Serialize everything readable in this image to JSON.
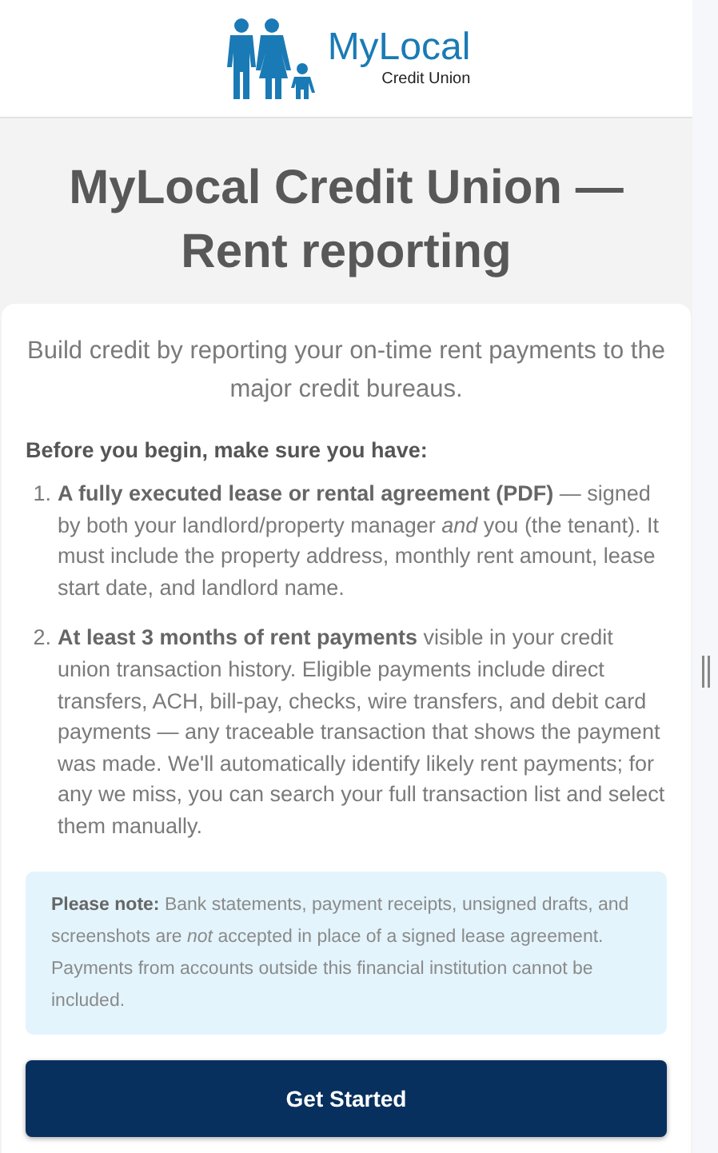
{
  "header": {
    "logo_name": "MyLocal",
    "logo_tagline": "Credit Union"
  },
  "title": "MyLocal Credit Union — Rent reporting",
  "lead": "Build credit by reporting your on-time rent payments to the major credit bureaus.",
  "checklist": {
    "heading": "Before you begin, make sure you have:",
    "items": [
      {
        "number": "1.",
        "text": "**A fully executed lease or rental agreement (PDF)** — signed by both your landlord/property manager *and* you (the tenant). It must include the property address, monthly rent amount, lease start date, and landlord name."
      },
      {
        "number": "2.",
        "text": "**At least 3 months of rent payments** visible in your credit union transaction history. Eligible payments include direct transfers, ACH, bill-pay, checks, wire transfers, and debit card payments — any traceable transaction that shows the payment was made. We'll automatically identify likely rent payments; for any we miss, you can search your full transaction list and select them manually."
      }
    ]
  },
  "note": "**Please note:** Bank statements, payment receipts, unsigned drafts, and screenshots are *not* accepted in place of a signed lease agreement. Payments from accounts outside this financial institution cannot be included.",
  "button": "Get Started"
}
